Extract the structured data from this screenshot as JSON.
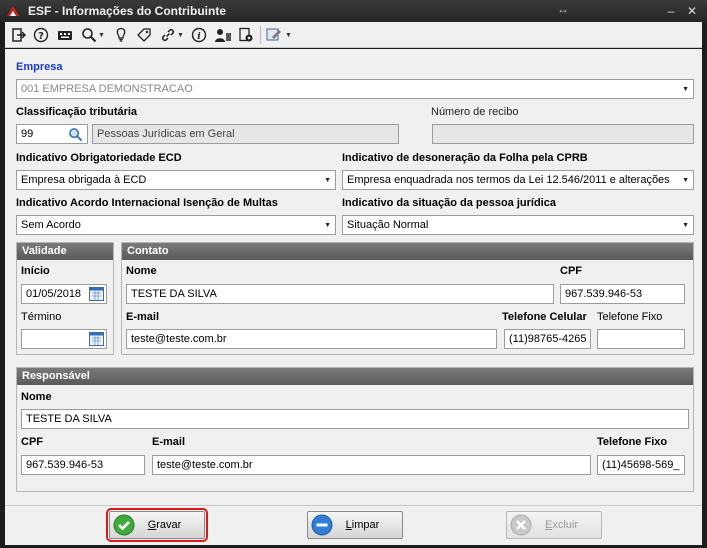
{
  "window": {
    "title": "ESF - Informações do Contribuinte",
    "resize_glyph": "↔",
    "minimize": "–",
    "close": "✕"
  },
  "toolbar": {
    "icons": [
      "exit-icon",
      "help-icon",
      "keyboard-icon",
      "search-icon",
      "lightbulb-icon",
      "tag-icon",
      "link-icon",
      "info-icon",
      "user-icon",
      "settings-doc-icon",
      "tools-icon"
    ]
  },
  "empresa": {
    "label": "Empresa",
    "value": "001 EMPRESA DEMONSTRACAO"
  },
  "classificacao": {
    "label": "Classificação tributária",
    "code": "99",
    "description": "Pessoas Jurídicas em Geral"
  },
  "recibo": {
    "label": "Número de recibo",
    "value": ""
  },
  "ecd": {
    "label": "Indicativo Obrigatoriedade ECD",
    "value": "Empresa obrigada à ECD"
  },
  "cprb": {
    "label": "Indicativo de desoneração da  Folha pela CPRB",
    "value": "Empresa enquadrada nos termos da Lei 12.546/2011 e alterações"
  },
  "acordo": {
    "label": "Indicativo Acordo Internacional Isenção de Multas",
    "value": "Sem Acordo"
  },
  "situacao": {
    "label": "Indicativo da situação da pessoa jurídica",
    "value": "Situação Normal"
  },
  "validade": {
    "title": "Validade",
    "inicio_label": "Início",
    "inicio_value": "01/05/2018",
    "termino_label": "Término",
    "termino_value": ""
  },
  "contato": {
    "title": "Contato",
    "nome_label": "Nome",
    "nome_value": "TESTE DA SILVA",
    "cpf_label": "CPF",
    "cpf_value": "967.539.946-53",
    "email_label": "E-mail",
    "email_value": "teste@teste.com.br",
    "cel_label": "Telefone Celular",
    "cel_value": "(11)98765-4265",
    "fixo_label": "Telefone Fixo",
    "fixo_value": ""
  },
  "responsavel": {
    "title": "Responsável",
    "nome_label": "Nome",
    "nome_value": "TESTE DA SILVA",
    "cpf_label": "CPF",
    "cpf_value": "967.539.946-53",
    "email_label": "E-mail",
    "email_value": "teste@teste.com.br",
    "fixo_label": "Telefone Fixo",
    "fixo_value": "(11)45698-569_"
  },
  "buttons": {
    "gravar_hot": "G",
    "gravar_rest": "ravar",
    "limpar_hot": "L",
    "limpar_rest": "impar",
    "excluir_hot": "E",
    "excluir_rest": "xcluir"
  }
}
